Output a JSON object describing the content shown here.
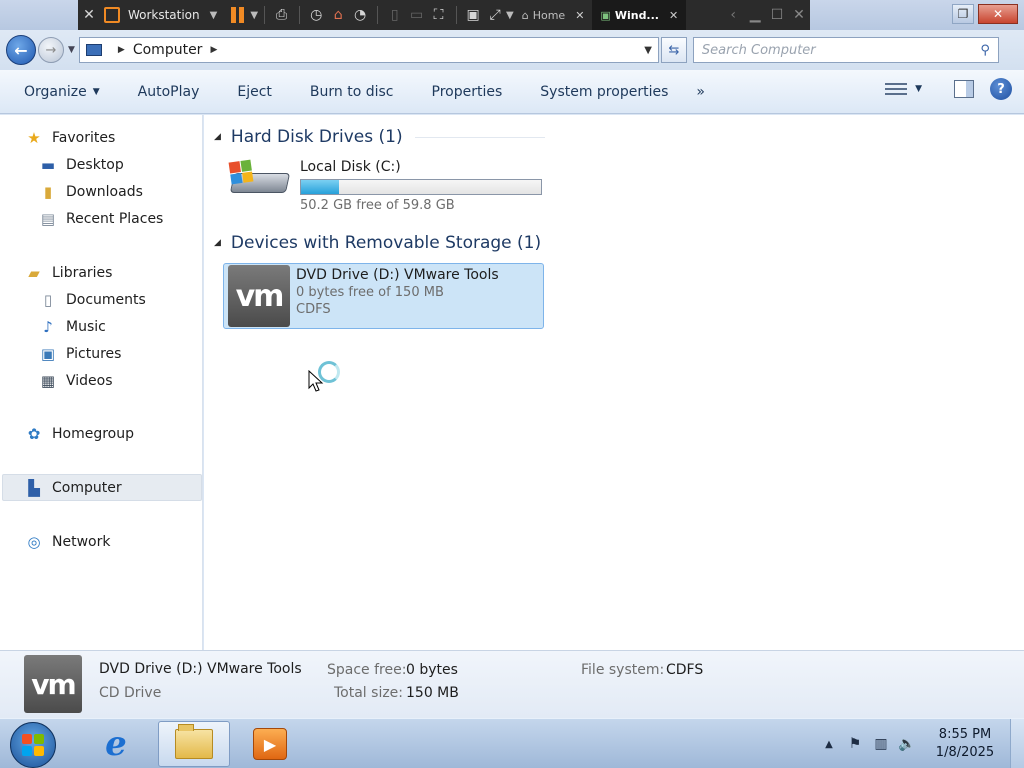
{
  "vmware": {
    "product": "Workstation",
    "tabs": [
      {
        "label": "Home",
        "active": false
      },
      {
        "label": "Wind...",
        "active": true
      }
    ]
  },
  "address": {
    "breadcrumb": "Computer",
    "search_placeholder": "Search Computer"
  },
  "toolbar": {
    "organize": "Organize",
    "autoplay": "AutoPlay",
    "eject": "Eject",
    "burn": "Burn to disc",
    "properties": "Properties",
    "system_properties": "System properties",
    "more": "»"
  },
  "nav": {
    "favorites": "Favorites",
    "desktop": "Desktop",
    "downloads": "Downloads",
    "recent": "Recent Places",
    "libraries": "Libraries",
    "documents": "Documents",
    "music": "Music",
    "pictures": "Pictures",
    "videos": "Videos",
    "homegroup": "Homegroup",
    "computer": "Computer",
    "network": "Network"
  },
  "groups": {
    "hdd_header": "Hard Disk Drives (1)",
    "removable_header": "Devices with Removable Storage (1)"
  },
  "drives": {
    "local": {
      "name": "Local Disk (C:)",
      "free_text": "50.2 GB free of 59.8 GB",
      "used_fraction": 0.16
    },
    "dvd": {
      "name": "DVD Drive (D:) VMware Tools",
      "free_text": "0 bytes free of 150 MB",
      "fs": "CDFS",
      "logo": "vm"
    }
  },
  "details": {
    "name": "DVD Drive (D:) VMware Tools",
    "type": "CD Drive",
    "space_free_label": "Space free:",
    "space_free": "0 bytes",
    "total_size_label": "Total size:",
    "total_size": "150 MB",
    "fs_label": "File system:",
    "fs": "CDFS"
  },
  "taskbar": {
    "time": "8:55 PM",
    "date": "1/8/2025"
  },
  "colors": {
    "accent": "#1e3a64",
    "selection": "#cce4f7",
    "progress": "#26a0da"
  }
}
